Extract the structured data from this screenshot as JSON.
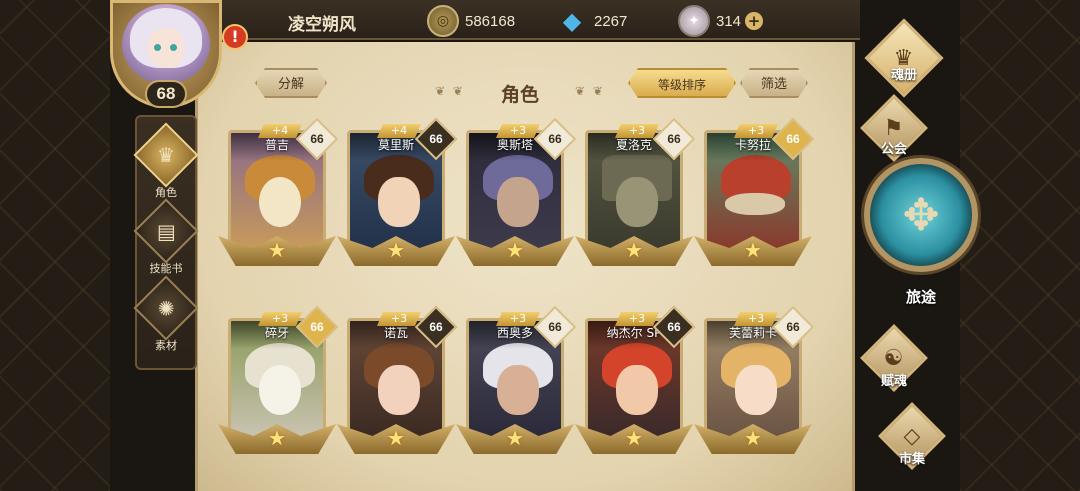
{
  "header": {
    "player_name": "凌空朔风",
    "gold": "586168",
    "crystal": "2267",
    "gem": "314",
    "level": "68",
    "alert": "!",
    "plus": "+"
  },
  "panel": {
    "title": "角色",
    "decompose_label": "分解",
    "sort_label": "等级排序",
    "filter_label": "筛选"
  },
  "side_menu": [
    {
      "label": "角色",
      "icon": "hero-icon"
    },
    {
      "label": "技能书",
      "icon": "skillbook-icon"
    },
    {
      "label": "素材",
      "icon": "material-icon"
    }
  ],
  "characters": [
    {
      "name": "普吉",
      "plus": "+4",
      "level": "66"
    },
    {
      "name": "莫里斯",
      "plus": "+4",
      "level": "66"
    },
    {
      "name": "奥斯塔",
      "plus": "+3",
      "level": "66"
    },
    {
      "name": "夏洛克",
      "plus": "+3",
      "level": "66"
    },
    {
      "name": "卡努拉",
      "plus": "+3",
      "level": "66"
    },
    {
      "name": "碎牙",
      "plus": "+3",
      "level": "66"
    },
    {
      "name": "诺瓦",
      "plus": "+3",
      "level": "66"
    },
    {
      "name": "西奥多",
      "plus": "+3",
      "level": "66"
    },
    {
      "name": "纳杰尔 SP",
      "plus": "+3",
      "level": "66"
    },
    {
      "name": "芙蕾莉卡",
      "plus": "+3",
      "level": "66"
    }
  ],
  "right_nav": {
    "soul_book": "魂册",
    "guild": "公会",
    "journey": "旅途",
    "fate": "赋魂",
    "market": "市集"
  }
}
